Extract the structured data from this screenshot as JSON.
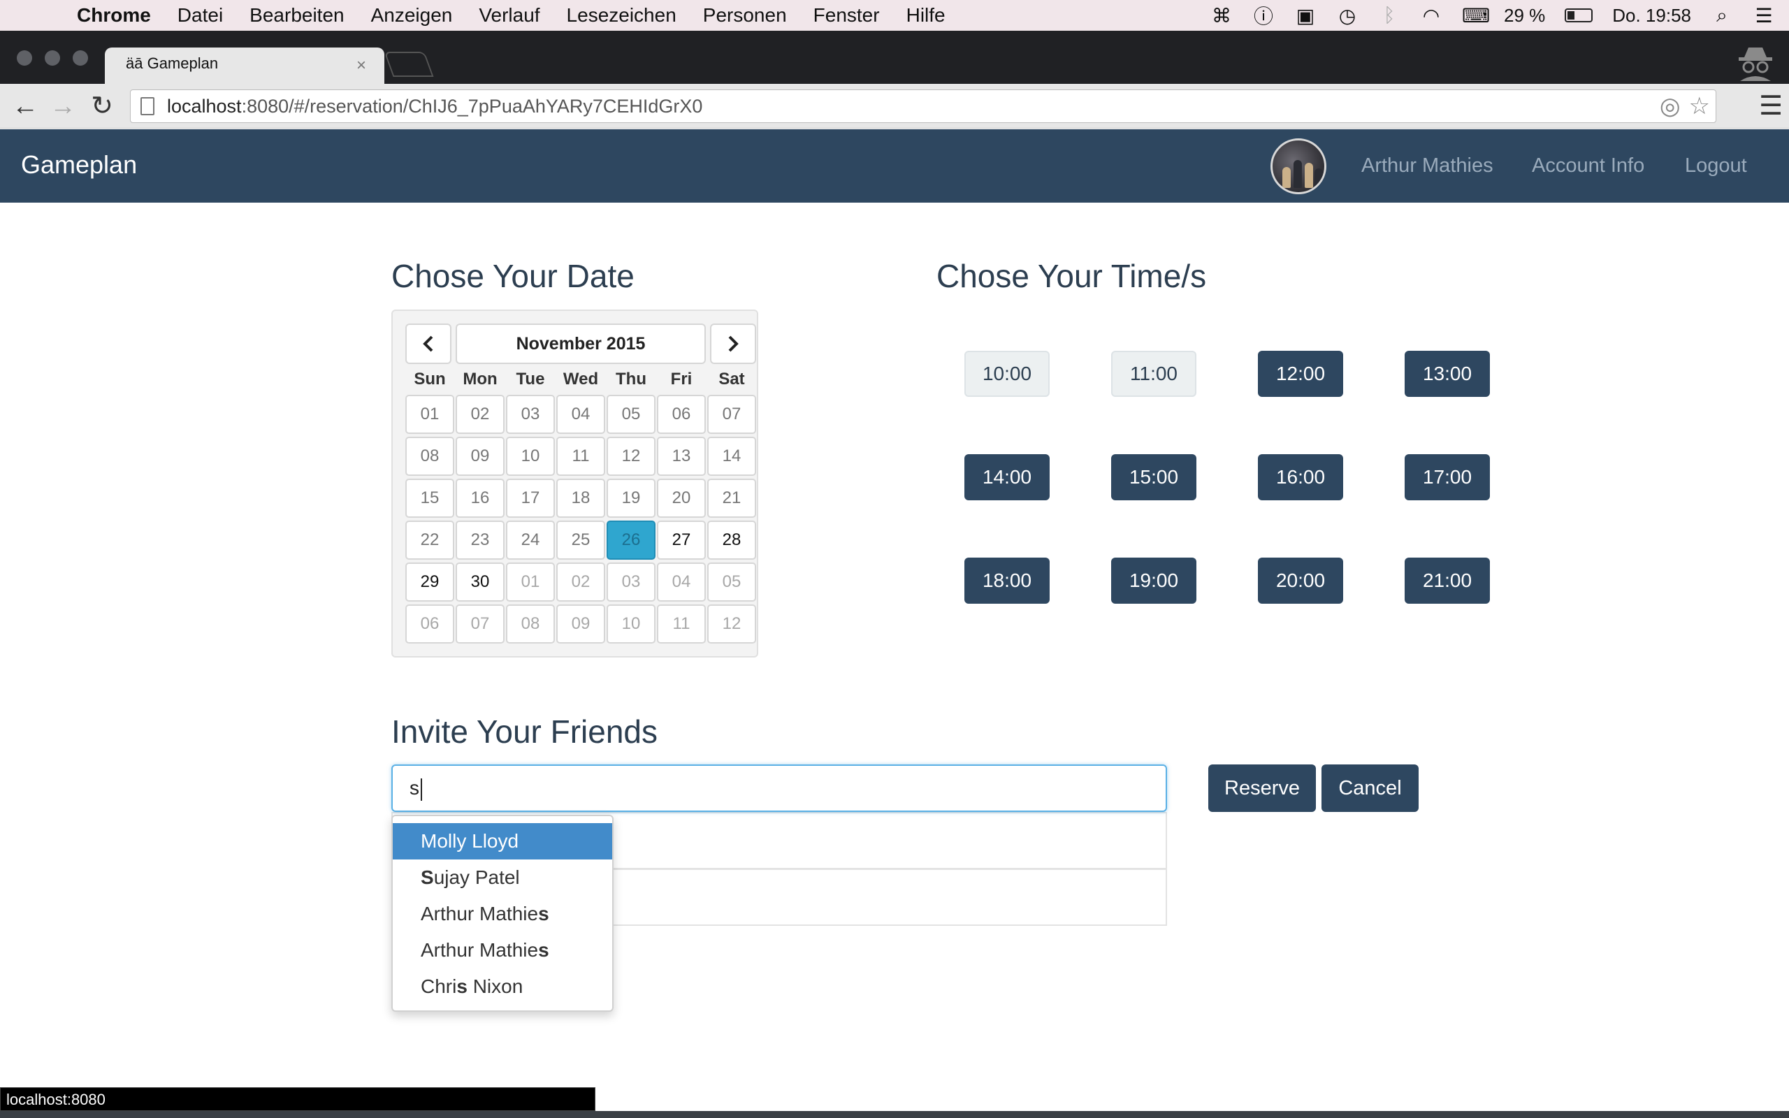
{
  "mac_menubar": {
    "app_name": "Chrome",
    "items": [
      "Datei",
      "Bearbeiten",
      "Anzeigen",
      "Verlauf",
      "Lesezeichen",
      "Personen",
      "Fenster",
      "Hilfe"
    ],
    "battery": "29 %",
    "clock": "Do. 19:58",
    "status_icons": [
      "command-icon",
      "onepassword-icon",
      "bookmark-app-icon",
      "time-machine-icon",
      "bluetooth-icon",
      "wifi-icon",
      "keyboard-icon",
      "battery-icon",
      "spotlight-search-icon",
      "notification-center-icon"
    ]
  },
  "browser": {
    "tab_title": "äā Gameplan",
    "url_host": "localhost",
    "url_rest": ":8080/#/reservation/ChIJ6_7pPuaAhYARy7CEHIdGrX0",
    "status_bubble": "localhost:8080"
  },
  "navbar": {
    "brand": "Gameplan",
    "user_name": "Arthur Mathies",
    "account_info": "Account Info",
    "logout": "Logout"
  },
  "date_section": {
    "heading": "Chose Your Date",
    "month_label": "November 2015",
    "prev_icon": "chevron-left-icon",
    "next_icon": "chevron-right-icon",
    "weekdays": [
      "Sun",
      "Mon",
      "Tue",
      "Wed",
      "Thu",
      "Fri",
      "Sat"
    ],
    "weeks": [
      [
        "01",
        "02",
        "03",
        "04",
        "05",
        "06",
        "07"
      ],
      [
        "08",
        "09",
        "10",
        "11",
        "12",
        "13",
        "14"
      ],
      [
        "15",
        "16",
        "17",
        "18",
        "19",
        "20",
        "21"
      ],
      [
        "22",
        "23",
        "24",
        "25",
        "26",
        "27",
        "28"
      ],
      [
        "29",
        "30",
        "01",
        "02",
        "03",
        "04",
        "05"
      ],
      [
        "06",
        "07",
        "08",
        "09",
        "10",
        "11",
        "12"
      ]
    ],
    "selected_day": "26"
  },
  "time_section": {
    "heading": "Chose Your Time/s",
    "slots": [
      {
        "label": "10:00",
        "available": false
      },
      {
        "label": "11:00",
        "available": false
      },
      {
        "label": "12:00",
        "available": true
      },
      {
        "label": "13:00",
        "available": true
      },
      {
        "label": "14:00",
        "available": true
      },
      {
        "label": "15:00",
        "available": true
      },
      {
        "label": "16:00",
        "available": true
      },
      {
        "label": "17:00",
        "available": true
      },
      {
        "label": "18:00",
        "available": true
      },
      {
        "label": "19:00",
        "available": true
      },
      {
        "label": "20:00",
        "available": true
      },
      {
        "label": "21:00",
        "available": true
      }
    ]
  },
  "invite_section": {
    "heading": "Invite Your Friends",
    "input_value": "s",
    "reserve_label": "Reserve",
    "cancel_label": "Cancel",
    "suggestions": [
      {
        "before": "Molly Lloyd",
        "match": "",
        "after": "",
        "active": true
      },
      {
        "before": "",
        "match": "S",
        "after": "ujay Patel",
        "active": false
      },
      {
        "before": "Arthur Mathie",
        "match": "s",
        "after": "",
        "active": false
      },
      {
        "before": "Arthur Mathie",
        "match": "s",
        "after": "",
        "active": false
      },
      {
        "before": "Chri",
        "match": "s",
        "after": " Nixon",
        "active": false
      }
    ]
  }
}
